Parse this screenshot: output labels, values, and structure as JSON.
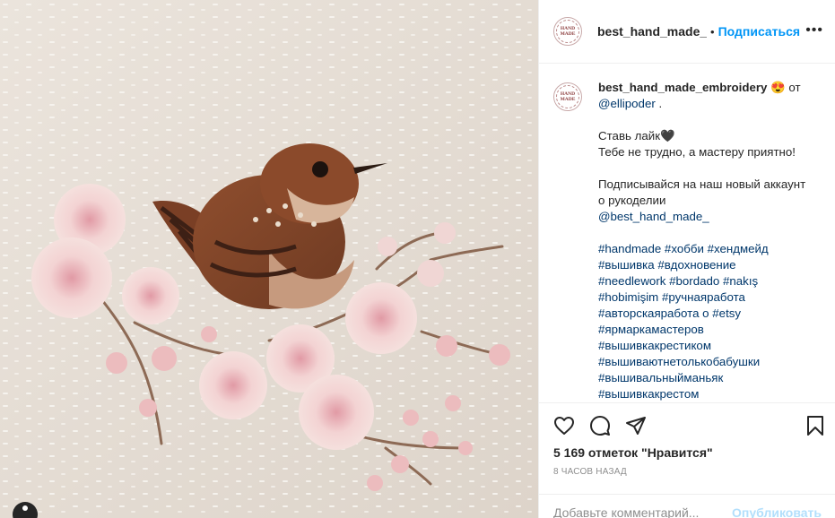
{
  "header": {
    "username": "best_hand_made_embroidery",
    "separator": "•",
    "follow_label": "Подписаться",
    "more_label": "•••",
    "avatar_text": [
      "HAND",
      "MADE"
    ]
  },
  "caption": {
    "username": "best_hand_made_embroidery",
    "emoji": "😍",
    "by_text": "от",
    "mention": "@ellipoder",
    "mention_suffix": ".",
    "line1": "Ставь лайк🖤",
    "line2": "Тебе не трудно, а мастеру приятно!",
    "line3": "Подписывайся на наш новый аккаунт о рукоделии",
    "new_account": "@best_hand_made_",
    "hashtags": [
      "#handmade #хобби #хендмейд",
      "#вышивка #вдохновение",
      "#needlework #bordado #nakış",
      "#hobimişim #ручнаяработа",
      "#авторскаяработа о #etsy",
      "#ярмаркамастеров",
      "#вышивкакрестиком",
      "#вышиваютнетолькобабушки",
      "#вышивальныйманьяк",
      "#вышивкакрестом"
    ]
  },
  "actions": {
    "icons": [
      "heart-icon",
      "comment-icon",
      "share-icon",
      "bookmark-icon"
    ],
    "likes": "5 169 отметок \"Нравится\"",
    "time": "8 ЧАСОВ НАЗАД"
  },
  "comment": {
    "placeholder": "Добавьте комментарий...",
    "publish_label": "Опубликовать"
  },
  "colors": {
    "link": "#00376b",
    "follow": "#0095f6",
    "publish_disabled": "#b2dffc",
    "muted": "#8e8e8e"
  }
}
